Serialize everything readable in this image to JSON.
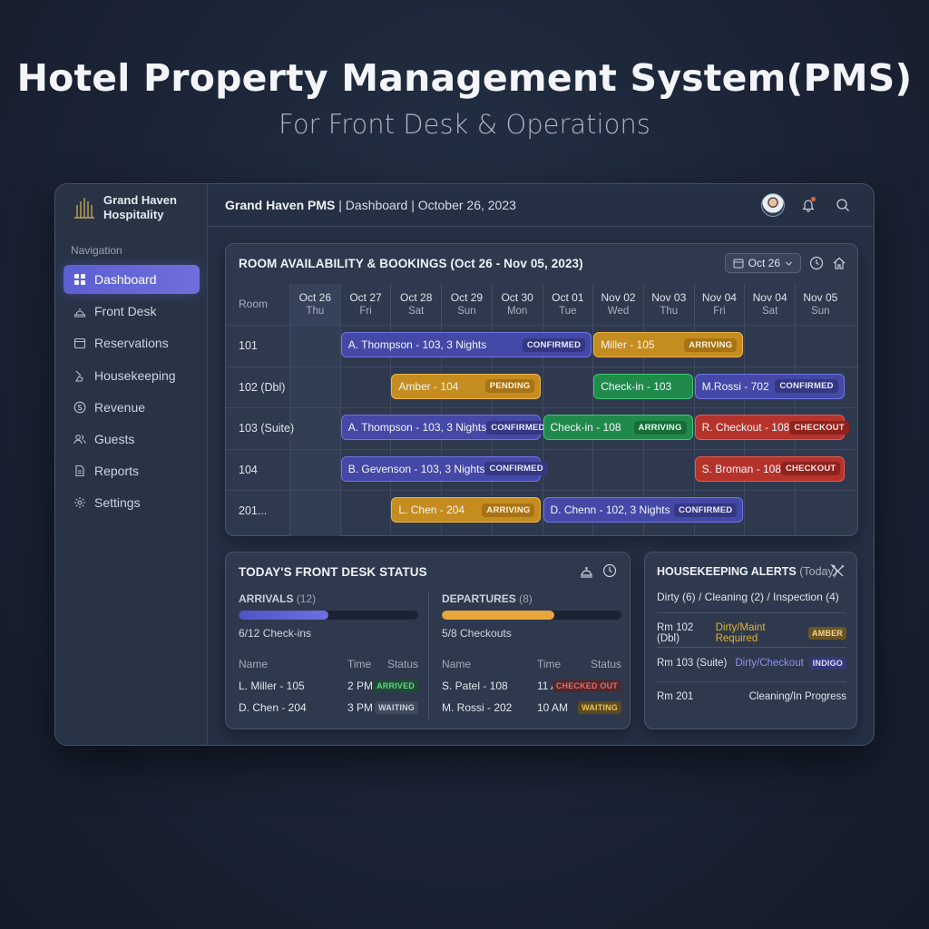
{
  "hero": {
    "title": "Hotel Property Management System(PMS)",
    "subtitle": "For Front Desk & Operations"
  },
  "brand": {
    "line1": "Grand Haven",
    "line2": "Hospitality"
  },
  "sidebar": {
    "heading": "Navigation",
    "items": [
      {
        "label": "Dashboard",
        "icon": "dashboard-grid-icon",
        "active": true
      },
      {
        "label": "Front Desk",
        "icon": "front-desk-bell-icon"
      },
      {
        "label": "Reservations",
        "icon": "calendar-icon"
      },
      {
        "label": "Housekeeping",
        "icon": "broom-icon"
      },
      {
        "label": "Revenue",
        "icon": "dollar-icon"
      },
      {
        "label": "Guests",
        "icon": "users-icon"
      },
      {
        "label": "Reports",
        "icon": "document-icon"
      },
      {
        "label": "Settings",
        "icon": "gear-icon"
      }
    ]
  },
  "topbar": {
    "app": "Grand Haven PMS",
    "section": "Dashboard",
    "date": "October 26, 2023"
  },
  "calendar": {
    "title": "ROOM AVAILABILITY & BOOKINGS (Oct 26 - Nov 05, 2023)",
    "date_picker": "Oct 26",
    "room_header": "Room",
    "days": [
      {
        "date": "Oct 26",
        "weekday": "Thu"
      },
      {
        "date": "Oct 27",
        "weekday": "Fri"
      },
      {
        "date": "Oct 28",
        "weekday": "Sat"
      },
      {
        "date": "Oct 29",
        "weekday": "Sun"
      },
      {
        "date": "Oct 30",
        "weekday": "Mon"
      },
      {
        "date": "Oct 01",
        "weekday": "Tue"
      },
      {
        "date": "Nov 02",
        "weekday": "Wed"
      },
      {
        "date": "Nov 03",
        "weekday": "Thu"
      },
      {
        "date": "Nov 04",
        "weekday": "Fri"
      },
      {
        "date": "Nov 04",
        "weekday": "Sat"
      },
      {
        "date": "Nov 05",
        "weekday": "Sun"
      }
    ],
    "rooms": [
      "101",
      "102 (Dbl)",
      "103 (Suite)",
      "104",
      "201..."
    ],
    "bookings": [
      {
        "room": 0,
        "start": 1,
        "span": 5,
        "label": "A. Thompson - 103, 3 Nights",
        "tag": "CONFIRMED",
        "color": "blue"
      },
      {
        "room": 0,
        "start": 6,
        "span": 3,
        "label": "Miller - 105",
        "tag": "ARRIVING",
        "color": "amber"
      },
      {
        "room": 1,
        "start": 2,
        "span": 3,
        "label": "Amber - 104",
        "tag": "PENDING",
        "color": "amber"
      },
      {
        "room": 1,
        "start": 6,
        "span": 2,
        "label": "Check-in - 103",
        "tag": "",
        "color": "green"
      },
      {
        "room": 1,
        "start": 8,
        "span": 3,
        "label": "M.Rossi - 702",
        "tag": "CONFIRMED",
        "color": "blue"
      },
      {
        "room": 2,
        "start": 1,
        "span": 4,
        "label": "A. Thompson - 103, 3 Nights",
        "tag": "CONFIRMED",
        "color": "blue"
      },
      {
        "room": 2,
        "start": 5,
        "span": 3,
        "label": "Check-in - 108",
        "tag": "ARRIVING",
        "color": "green"
      },
      {
        "room": 2,
        "start": 8,
        "span": 3,
        "label": "R. Checkout - 108",
        "tag": "CHECKOUT",
        "color": "red"
      },
      {
        "room": 3,
        "start": 1,
        "span": 4,
        "label": "B. Gevenson - 103, 3 Nights",
        "tag": "CONFIRMED",
        "color": "blue"
      },
      {
        "room": 3,
        "start": 8,
        "span": 3,
        "label": "S. Broman - 108",
        "tag": "CHECKOUT",
        "color": "red"
      },
      {
        "room": 4,
        "start": 2,
        "span": 3,
        "label": "L. Chen - 204",
        "tag": "ARRIVING",
        "color": "amber"
      },
      {
        "room": 4,
        "start": 5,
        "span": 4,
        "label": "D. Chenn - 102, 3 Nights",
        "tag": "CONFIRMED",
        "color": "blue"
      }
    ]
  },
  "front_desk": {
    "title": "TODAY'S FRONT DESK STATUS",
    "arrivals": {
      "label": "ARRIVALS",
      "count": "(12)",
      "progress": 0.5,
      "note": "6/12 Check-ins",
      "cols": [
        "Name",
        "Time",
        "Status"
      ],
      "rows": [
        {
          "name": "L. Miller - 105",
          "time": "2 PM",
          "status": "ARRIVED",
          "kind": "green"
        },
        {
          "name": "D. Chen - 204",
          "time": "3 PM",
          "status": "WAITING",
          "kind": "gray"
        }
      ]
    },
    "departures": {
      "label": "DEPARTURES",
      "count": "(8)",
      "progress": 0.625,
      "note": "5/8 Checkouts",
      "cols": [
        "Name",
        "Time",
        "Status"
      ],
      "rows": [
        {
          "name": "S. Patel - 108",
          "time": "11 AM",
          "status": "CHECKED OUT",
          "kind": "red"
        },
        {
          "name": "M. Rossi - 202",
          "time": "10 AM",
          "status": "WAITING",
          "kind": "amber"
        }
      ]
    }
  },
  "housekeeping": {
    "title": "HOUSEKEEPING ALERTS",
    "title_note": "(Today)",
    "summary": "Dirty (6) / Cleaning (2) / Inspection (4)",
    "rows": [
      {
        "room": "Rm 102 (Dbl)",
        "status": "Dirty/Maint Required",
        "badge": "AMBER",
        "status_color": "#e5b12e",
        "badge_bg": "#6a5424",
        "badge_fg": "#f3d48a"
      },
      {
        "room": "Rm 103 (Suite)",
        "status": "Dirty/Checkout",
        "badge": "INDIGO",
        "status_color": "#8d93f0",
        "badge_bg": "#34397a",
        "badge_fg": "#d9dcff"
      },
      {
        "room": "Rm 201",
        "status": "Cleaning/In Progress",
        "badge": "",
        "status_color": "#dfe4ec"
      }
    ]
  },
  "colors": {
    "accent": "#6366d8",
    "arrivals_bar": "#6c70e0",
    "departures_bar": "#e8a73a"
  }
}
